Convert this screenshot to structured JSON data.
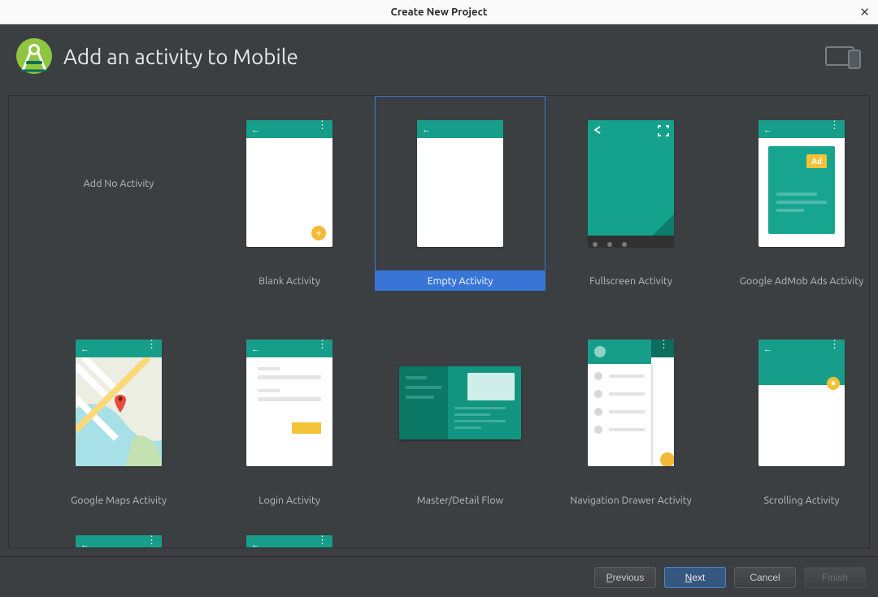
{
  "window": {
    "title": "Create New Project"
  },
  "header": {
    "heading": "Add an activity to Mobile"
  },
  "selected_index": 2,
  "templates": [
    {
      "label": "Add No Activity",
      "kind": "none"
    },
    {
      "label": "Blank Activity",
      "kind": "blank"
    },
    {
      "label": "Empty Activity",
      "kind": "empty"
    },
    {
      "label": "Fullscreen Activity",
      "kind": "fullscreen"
    },
    {
      "label": "Google AdMob Ads Activity",
      "kind": "admob",
      "ad_text": "Ad"
    },
    {
      "label": "Google Maps Activity",
      "kind": "maps"
    },
    {
      "label": "Login Activity",
      "kind": "login"
    },
    {
      "label": "Master/Detail Flow",
      "kind": "masterdetail"
    },
    {
      "label": "Navigation Drawer Activity",
      "kind": "navdrawer"
    },
    {
      "label": "Scrolling Activity",
      "kind": "scrolling"
    },
    {
      "label": "",
      "kind": "partial"
    },
    {
      "label": "",
      "kind": "partial"
    }
  ],
  "buttons": {
    "previous": "Previous",
    "next": "Next",
    "cancel": "Cancel",
    "finish": "Finish"
  },
  "colors": {
    "teal": "#179e8a",
    "teal_dark": "#0b7865",
    "accent_blue": "#3875d7",
    "fab_yellow": "#f4b936"
  }
}
